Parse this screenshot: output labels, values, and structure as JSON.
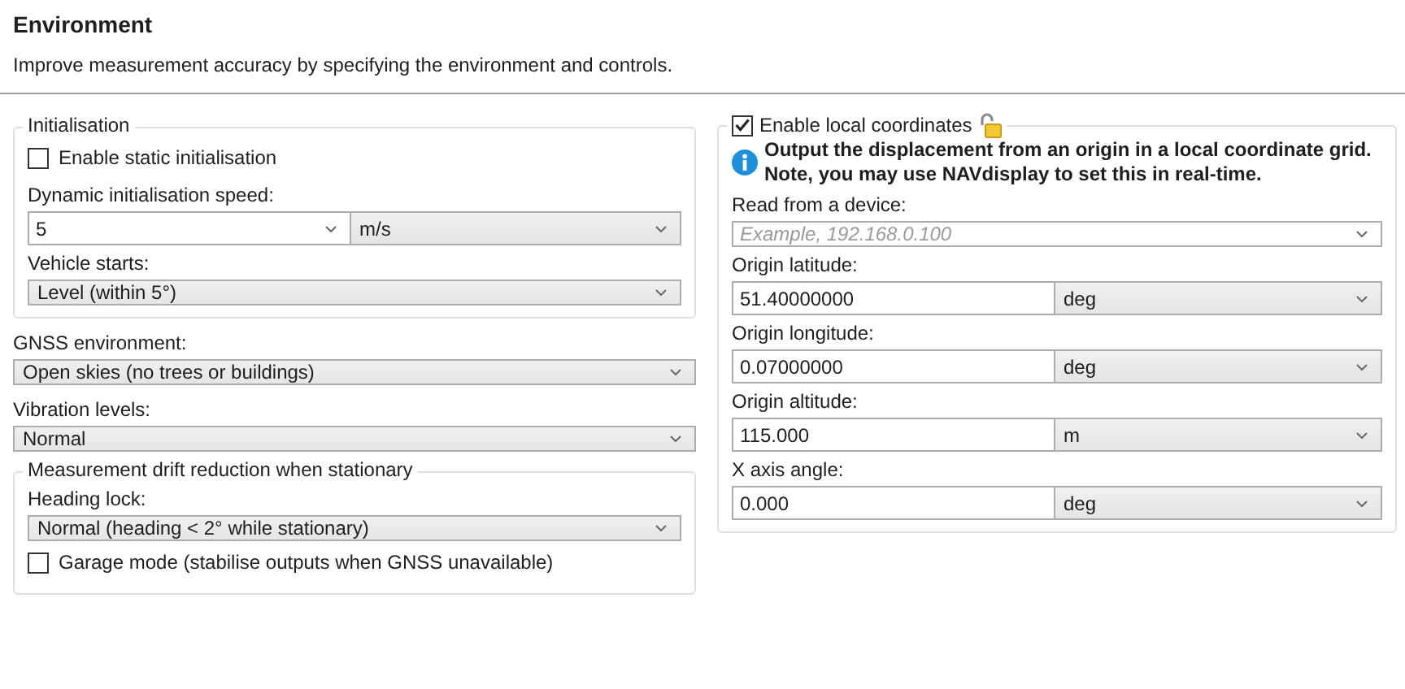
{
  "header": {
    "title": "Environment",
    "description": "Improve measurement accuracy by specifying the environment and controls."
  },
  "left": [
    {
      "kind": "group",
      "title": "Initialisation",
      "items": [
        {
          "kind": "checkbox",
          "label": "Enable static initialisation",
          "checked": false
        },
        {
          "kind": "combo-unit",
          "label": "Dynamic initialisation speed:",
          "value": "5",
          "unit": "m/s"
        },
        {
          "kind": "select",
          "label": "Vehicle starts:",
          "value": "Level (within 5°)"
        }
      ]
    },
    {
      "kind": "select",
      "label": "GNSS environment:",
      "value": "Open skies (no trees or buildings)"
    },
    {
      "kind": "select",
      "label": "Vibration levels:",
      "value": "Normal"
    },
    {
      "kind": "group",
      "title": "Measurement drift reduction when stationary",
      "items": [
        {
          "kind": "select",
          "label": "Heading lock:",
          "value": "Normal (heading < 2° while stationary)"
        },
        {
          "kind": "checkbox",
          "label": "Garage mode (stabilise outputs when GNSS unavailable)",
          "checked": false
        }
      ]
    }
  ],
  "right": {
    "label": "Enable local coordinates",
    "checked": true,
    "note": "Output the displacement from an origin in a local coordinate grid.\nNote, you may use NAVdisplay to set this in real-time.",
    "items": [
      {
        "kind": "combo-placeholder",
        "label": "Read from a device:",
        "placeholder": "Example, 192.168.0.100"
      },
      {
        "kind": "text-unit",
        "label": "Origin latitude:",
        "value": "51.40000000",
        "unit": "deg"
      },
      {
        "kind": "text-unit",
        "label": "Origin longitude:",
        "value": "0.07000000",
        "unit": "deg"
      },
      {
        "kind": "text-unit",
        "label": "Origin altitude:",
        "value": "115.000",
        "unit": "m"
      },
      {
        "kind": "text-unit",
        "label": "X axis angle:",
        "value": "0.000",
        "unit": "deg"
      }
    ]
  }
}
